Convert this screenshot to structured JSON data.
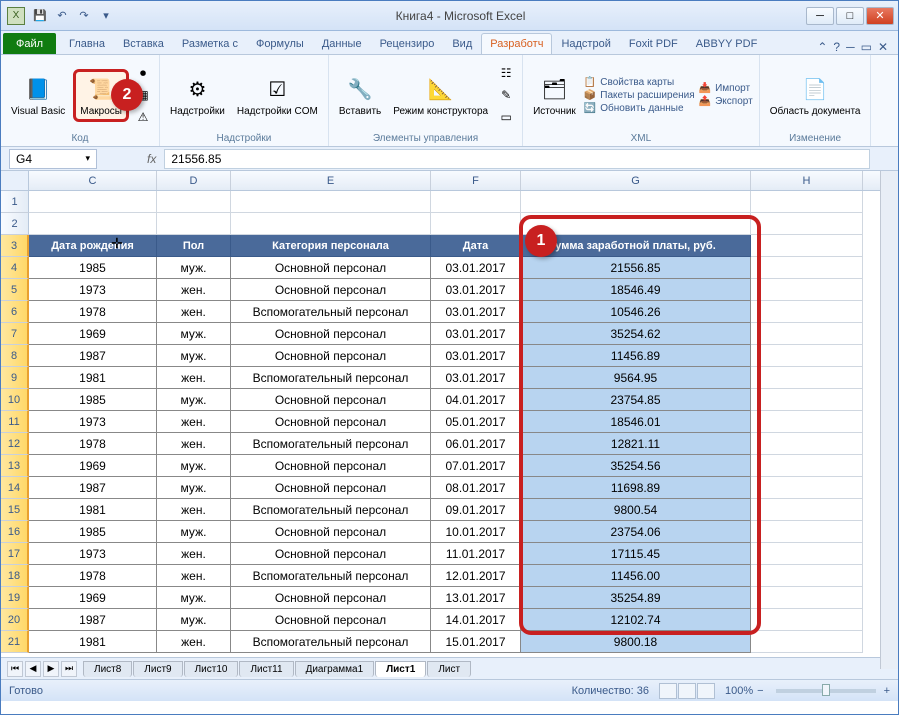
{
  "app_title": "Книга4 - Microsoft Excel",
  "ribbon": {
    "tabs": [
      "Файл",
      "Главна",
      "Вставка",
      "Разметка с",
      "Формулы",
      "Данные",
      "Рецензиро",
      "Вид",
      "Разработч",
      "Надстрой",
      "Foxit PDF",
      "ABBYY PDF"
    ],
    "active_tab": "Разработч",
    "groups": {
      "code": {
        "label": "Код",
        "vb": "Visual Basic",
        "macros": "Макросы"
      },
      "addins": {
        "label": "Надстройки",
        "addins_btn": "Надстройки",
        "com": "Надстройки COM"
      },
      "controls": {
        "label": "Элементы управления",
        "insert": "Вставить",
        "design": "Режим конструктора"
      },
      "xml": {
        "label": "XML",
        "source": "Источник",
        "map_props": "Свойства карты",
        "expansion": "Пакеты расширения",
        "refresh": "Обновить данные",
        "import": "Импорт",
        "export": "Экспорт"
      },
      "modify": {
        "label": "Изменение",
        "doc_area": "Область документа"
      }
    }
  },
  "name_box": "G4",
  "formula_value": "21556.85",
  "columns": [
    "C",
    "D",
    "E",
    "F",
    "G",
    "H"
  ],
  "headers": {
    "C": "Дата рождения",
    "D": "Пол",
    "E": "Категория персонала",
    "F": "Дата",
    "G": "умма заработной платы, руб."
  },
  "rows": [
    {
      "n": 4,
      "C": "1985",
      "D": "муж.",
      "E": "Основной персонал",
      "F": "03.01.2017",
      "G": "21556.85"
    },
    {
      "n": 5,
      "C": "1973",
      "D": "жен.",
      "E": "Основной персонал",
      "F": "03.01.2017",
      "G": "18546.49"
    },
    {
      "n": 6,
      "C": "1978",
      "D": "жен.",
      "E": "Вспомогательный персонал",
      "F": "03.01.2017",
      "G": "10546.26"
    },
    {
      "n": 7,
      "C": "1969",
      "D": "муж.",
      "E": "Основной персонал",
      "F": "03.01.2017",
      "G": "35254.62"
    },
    {
      "n": 8,
      "C": "1987",
      "D": "муж.",
      "E": "Основной персонал",
      "F": "03.01.2017",
      "G": "11456.89"
    },
    {
      "n": 9,
      "C": "1981",
      "D": "жен.",
      "E": "Вспомогательный персонал",
      "F": "03.01.2017",
      "G": "9564.95"
    },
    {
      "n": 10,
      "C": "1985",
      "D": "муж.",
      "E": "Основной персонал",
      "F": "04.01.2017",
      "G": "23754.85"
    },
    {
      "n": 11,
      "C": "1973",
      "D": "жен.",
      "E": "Основной персонал",
      "F": "05.01.2017",
      "G": "18546.01"
    },
    {
      "n": 12,
      "C": "1978",
      "D": "жен.",
      "E": "Вспомогательный персонал",
      "F": "06.01.2017",
      "G": "12821.11"
    },
    {
      "n": 13,
      "C": "1969",
      "D": "муж.",
      "E": "Основной персонал",
      "F": "07.01.2017",
      "G": "35254.56"
    },
    {
      "n": 14,
      "C": "1987",
      "D": "муж.",
      "E": "Основной персонал",
      "F": "08.01.2017",
      "G": "11698.89"
    },
    {
      "n": 15,
      "C": "1981",
      "D": "жен.",
      "E": "Вспомогательный персонал",
      "F": "09.01.2017",
      "G": "9800.54"
    },
    {
      "n": 16,
      "C": "1985",
      "D": "муж.",
      "E": "Основной персонал",
      "F": "10.01.2017",
      "G": "23754.06"
    },
    {
      "n": 17,
      "C": "1973",
      "D": "жен.",
      "E": "Основной персонал",
      "F": "11.01.2017",
      "G": "17115.45"
    },
    {
      "n": 18,
      "C": "1978",
      "D": "жен.",
      "E": "Вспомогательный персонал",
      "F": "12.01.2017",
      "G": "11456.00"
    },
    {
      "n": 19,
      "C": "1969",
      "D": "муж.",
      "E": "Основной персонал",
      "F": "13.01.2017",
      "G": "35254.89"
    },
    {
      "n": 20,
      "C": "1987",
      "D": "муж.",
      "E": "Основной персонал",
      "F": "14.01.2017",
      "G": "12102.74"
    },
    {
      "n": 21,
      "C": "1981",
      "D": "жен.",
      "E": "Вспомогательный персонал",
      "F": "15.01.2017",
      "G": "9800.18"
    }
  ],
  "sheet_tabs": [
    "Лист8",
    "Лист9",
    "Лист10",
    "Лист11",
    "Диаграмма1",
    "Лист1",
    "Лист"
  ],
  "active_sheet": "Лист1",
  "status": {
    "ready": "Готово",
    "count_label": "Количество: 36",
    "zoom": "100%"
  },
  "callouts": {
    "one": "1",
    "two": "2"
  }
}
